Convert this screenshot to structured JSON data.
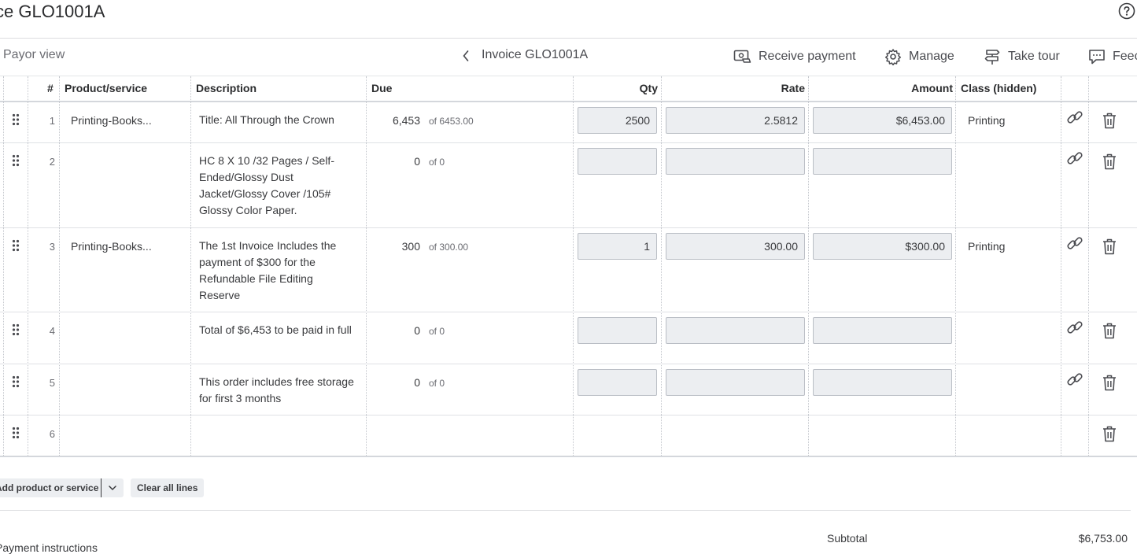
{
  "header": {
    "title": "ce GLO1001A",
    "help_icon": "question-circle-icon"
  },
  "toolbar": {
    "payor_view": "Payor view",
    "invoice_label": "Invoice GLO1001A",
    "receive_payment": "Receive payment",
    "manage": "Manage",
    "take_tour": "Take tour",
    "feedback": "Feec"
  },
  "table": {
    "headers": {
      "num": "#",
      "product": "Product/service",
      "description": "Description",
      "due": "Due",
      "qty": "Qty",
      "rate": "Rate",
      "amount": "Amount",
      "class": "Class (hidden)"
    },
    "rows": [
      {
        "num": "1",
        "product": "Printing-Books...",
        "description": "Title: All Through the Crown",
        "due": "6,453",
        "due_of": "of 6453.00",
        "qty": "2500",
        "rate": "2.5812",
        "amount": "$6,453.00",
        "class": "Printing"
      },
      {
        "num": "2",
        "product": "",
        "description": "HC 8 X 10 /32 Pages / Self-Ended/Glossy Dust Jacket/Glossy Cover /105# Glossy Color Paper.",
        "due": "0",
        "due_of": "of 0",
        "qty": "",
        "rate": "",
        "amount": "",
        "class": ""
      },
      {
        "num": "3",
        "product": "Printing-Books...",
        "description": "The 1st Invoice Includes the payment of $300 for the Refundable File Editing Reserve",
        "due": "300",
        "due_of": "of 300.00",
        "qty": "1",
        "rate": "300.00",
        "amount": "$300.00",
        "class": "Printing"
      },
      {
        "num": "4",
        "product": "",
        "description": "Total of $6,453 to be paid in full",
        "due": "0",
        "due_of": "of 0",
        "qty": "",
        "rate": "",
        "amount": "",
        "class": ""
      },
      {
        "num": "5",
        "product": "",
        "description": "This order includes free storage for first 3 months",
        "due": "0",
        "due_of": "of 0",
        "qty": "",
        "rate": "",
        "amount": "",
        "class": ""
      },
      {
        "num": "6",
        "product": "",
        "description": "",
        "due": "",
        "due_of": "",
        "qty": "",
        "rate": "",
        "amount": "",
        "class": ""
      }
    ]
  },
  "actions": {
    "add_product": "Add product or service",
    "clear_lines": "Clear all lines"
  },
  "footer": {
    "payment_instructions": "Payment instructions",
    "subtotal_label": "Subtotal",
    "subtotal_value": "$6,753.00"
  },
  "colors": {
    "text": "#393a3d",
    "input_bg": "#eceef1",
    "border": "#babec5",
    "divider": "#dcdde0"
  }
}
